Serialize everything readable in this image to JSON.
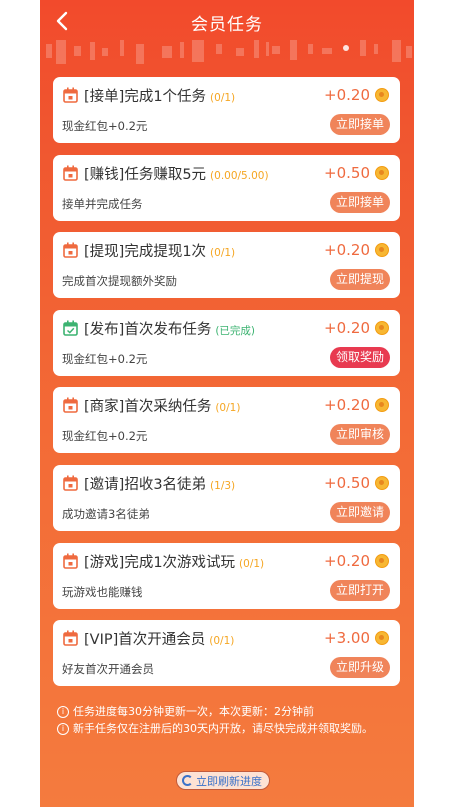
{
  "header": {
    "title": "会员任务",
    "back_icon": "chevron-left-icon"
  },
  "tasks": [
    {
      "title": "[接单]完成1个任务",
      "progress": "(0/1)",
      "reward": "+0.20",
      "subtitle": "现金红包+0.2元",
      "action": "立即接单",
      "status": "pending"
    },
    {
      "title": "[赚钱]任务赚取5元",
      "progress": "(0.00/5.00)",
      "reward": "+0.50",
      "subtitle": "接单并完成任务",
      "action": "立即接单",
      "status": "pending"
    },
    {
      "title": "[提现]完成提现1次",
      "progress": "(0/1)",
      "reward": "+0.20",
      "subtitle": "完成首次提现额外奖励",
      "action": "立即提现",
      "status": "pending"
    },
    {
      "title": "[发布]首次发布任务",
      "progress": "(已完成)",
      "reward": "+0.20",
      "subtitle": "现金红包+0.2元",
      "action": "领取奖励",
      "status": "done"
    },
    {
      "title": "[商家]首次采纳任务",
      "progress": "(0/1)",
      "reward": "+0.20",
      "subtitle": "现金红包+0.2元",
      "action": "立即审核",
      "status": "pending"
    },
    {
      "title": "[邀请]招收3名徒弟",
      "progress": "(1/3)",
      "reward": "+0.50",
      "subtitle": "成功邀请3名徒弟",
      "action": "立即邀请",
      "status": "pending"
    },
    {
      "title": "[游戏]完成1次游戏试玩",
      "progress": "(0/1)",
      "reward": "+0.20",
      "subtitle": "玩游戏也能赚钱",
      "action": "立即打开",
      "status": "pending"
    },
    {
      "title": "[VIP]首次开通会员",
      "progress": "(0/1)",
      "reward": "+3.00",
      "subtitle": "好友首次开通会员",
      "action": "立即升级",
      "status": "pending"
    }
  ],
  "notes": [
    "任务进度每30分钟更新一次，本次更新：2分钟前",
    "新手任务仅在注册后的30天内开放，请尽快完成并领取奖励。"
  ],
  "refresh_label": "立即刷新进度",
  "colors": {
    "header_bg": "#f24a2c",
    "reward_text": "#ef6a3f",
    "action_button": "#f0845a",
    "claim_button": "#e83a50",
    "progress_pending": "#f5a623",
    "progress_done": "#3cb371",
    "refresh_text": "#3a72c9"
  }
}
